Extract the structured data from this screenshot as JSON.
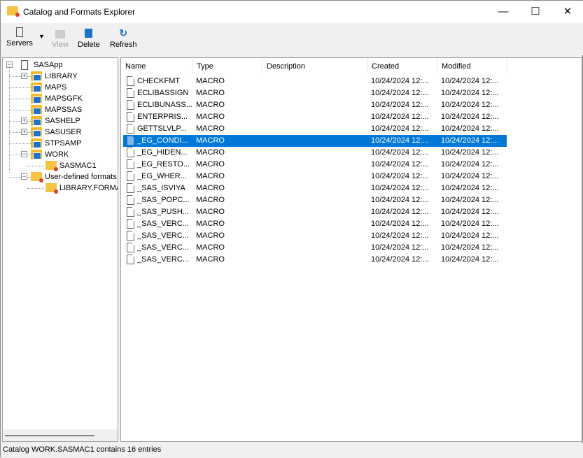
{
  "window": {
    "title": "Catalog and Formats Explorer",
    "minimize": "—",
    "maximize": "☐",
    "close": "✕"
  },
  "toolbar": {
    "servers": "Servers",
    "view": "View",
    "delete": "Delete",
    "refresh": "Refresh"
  },
  "tree": [
    {
      "label": "SASApp",
      "level": 0,
      "icon": "server-icon",
      "exp": "−"
    },
    {
      "label": "LIBRARY",
      "level": 1,
      "icon": "library-icon",
      "exp": "+"
    },
    {
      "label": "MAPS",
      "level": 1,
      "icon": "library-icon",
      "exp": ""
    },
    {
      "label": "MAPSGFK",
      "level": 1,
      "icon": "library-icon",
      "exp": ""
    },
    {
      "label": "MAPSSAS",
      "level": 1,
      "icon": "library-icon",
      "exp": ""
    },
    {
      "label": "SASHELP",
      "level": 1,
      "icon": "library-icon",
      "exp": "+"
    },
    {
      "label": "SASUSER",
      "level": 1,
      "icon": "library-icon",
      "exp": "+"
    },
    {
      "label": "STPSAMP",
      "level": 1,
      "icon": "library-icon",
      "exp": ""
    },
    {
      "label": "WORK",
      "level": 1,
      "icon": "library-icon",
      "exp": "−"
    },
    {
      "label": "SASMAC1",
      "level": 2,
      "icon": "catalog-icon",
      "exp": ""
    },
    {
      "label": "User-defined formats",
      "level": 1,
      "icon": "formats-folder-icon",
      "exp": "−"
    },
    {
      "label": "LIBRARY.FORMATS",
      "level": 2,
      "icon": "catalog-icon",
      "exp": ""
    }
  ],
  "columns": [
    "Name",
    "Type",
    "Description",
    "Created",
    "Modified"
  ],
  "rows": [
    {
      "name": "CHECKFMT",
      "type": "MACRO",
      "description": "",
      "created": "10/24/2024 12:...",
      "modified": "10/24/2024 12:..."
    },
    {
      "name": "ECLIBASSIGN",
      "type": "MACRO",
      "description": "",
      "created": "10/24/2024 12:...",
      "modified": "10/24/2024 12:..."
    },
    {
      "name": "ECLIBUNASS...",
      "type": "MACRO",
      "description": "",
      "created": "10/24/2024 12:...",
      "modified": "10/24/2024 12:..."
    },
    {
      "name": "ENTERPRIS...",
      "type": "MACRO",
      "description": "",
      "created": "10/24/2024 12:...",
      "modified": "10/24/2024 12:..."
    },
    {
      "name": "GETTSLVLP...",
      "type": "MACRO",
      "description": "",
      "created": "10/24/2024 12:...",
      "modified": "10/24/2024 12:..."
    },
    {
      "name": "_EG_CONDI...",
      "type": "MACRO",
      "description": "",
      "created": "10/24/2024 12:...",
      "modified": "10/24/2024 12:...",
      "selected": true
    },
    {
      "name": "_EG_HIDEN...",
      "type": "MACRO",
      "description": "",
      "created": "10/24/2024 12:...",
      "modified": "10/24/2024 12:..."
    },
    {
      "name": "_EG_RESTO...",
      "type": "MACRO",
      "description": "",
      "created": "10/24/2024 12:...",
      "modified": "10/24/2024 12:..."
    },
    {
      "name": "_EG_WHER...",
      "type": "MACRO",
      "description": "",
      "created": "10/24/2024 12:...",
      "modified": "10/24/2024 12:..."
    },
    {
      "name": "_SAS_ISVIYA",
      "type": "MACRO",
      "description": "",
      "created": "10/24/2024 12:...",
      "modified": "10/24/2024 12:..."
    },
    {
      "name": "_SAS_POPC...",
      "type": "MACRO",
      "description": "",
      "created": "10/24/2024 12:...",
      "modified": "10/24/2024 12:..."
    },
    {
      "name": "_SAS_PUSH...",
      "type": "MACRO",
      "description": "",
      "created": "10/24/2024 12:...",
      "modified": "10/24/2024 12:..."
    },
    {
      "name": "_SAS_VERC...",
      "type": "MACRO",
      "description": "",
      "created": "10/24/2024 12:...",
      "modified": "10/24/2024 12:..."
    },
    {
      "name": "_SAS_VERC...",
      "type": "MACRO",
      "description": "",
      "created": "10/24/2024 12:...",
      "modified": "10/24/2024 12:..."
    },
    {
      "name": "_SAS_VERC...",
      "type": "MACRO",
      "description": "",
      "created": "10/24/2024 12:...",
      "modified": "10/24/2024 12:..."
    },
    {
      "name": "_SAS_VERC...",
      "type": "MACRO",
      "description": "",
      "created": "10/24/2024 12:...",
      "modified": "10/24/2024 12:..."
    }
  ],
  "status": "Catalog WORK.SASMAC1 contains 16 entries",
  "colors": {
    "selection": "#0078d7",
    "accent": "#1d73c9",
    "folder": "#f6c343"
  }
}
